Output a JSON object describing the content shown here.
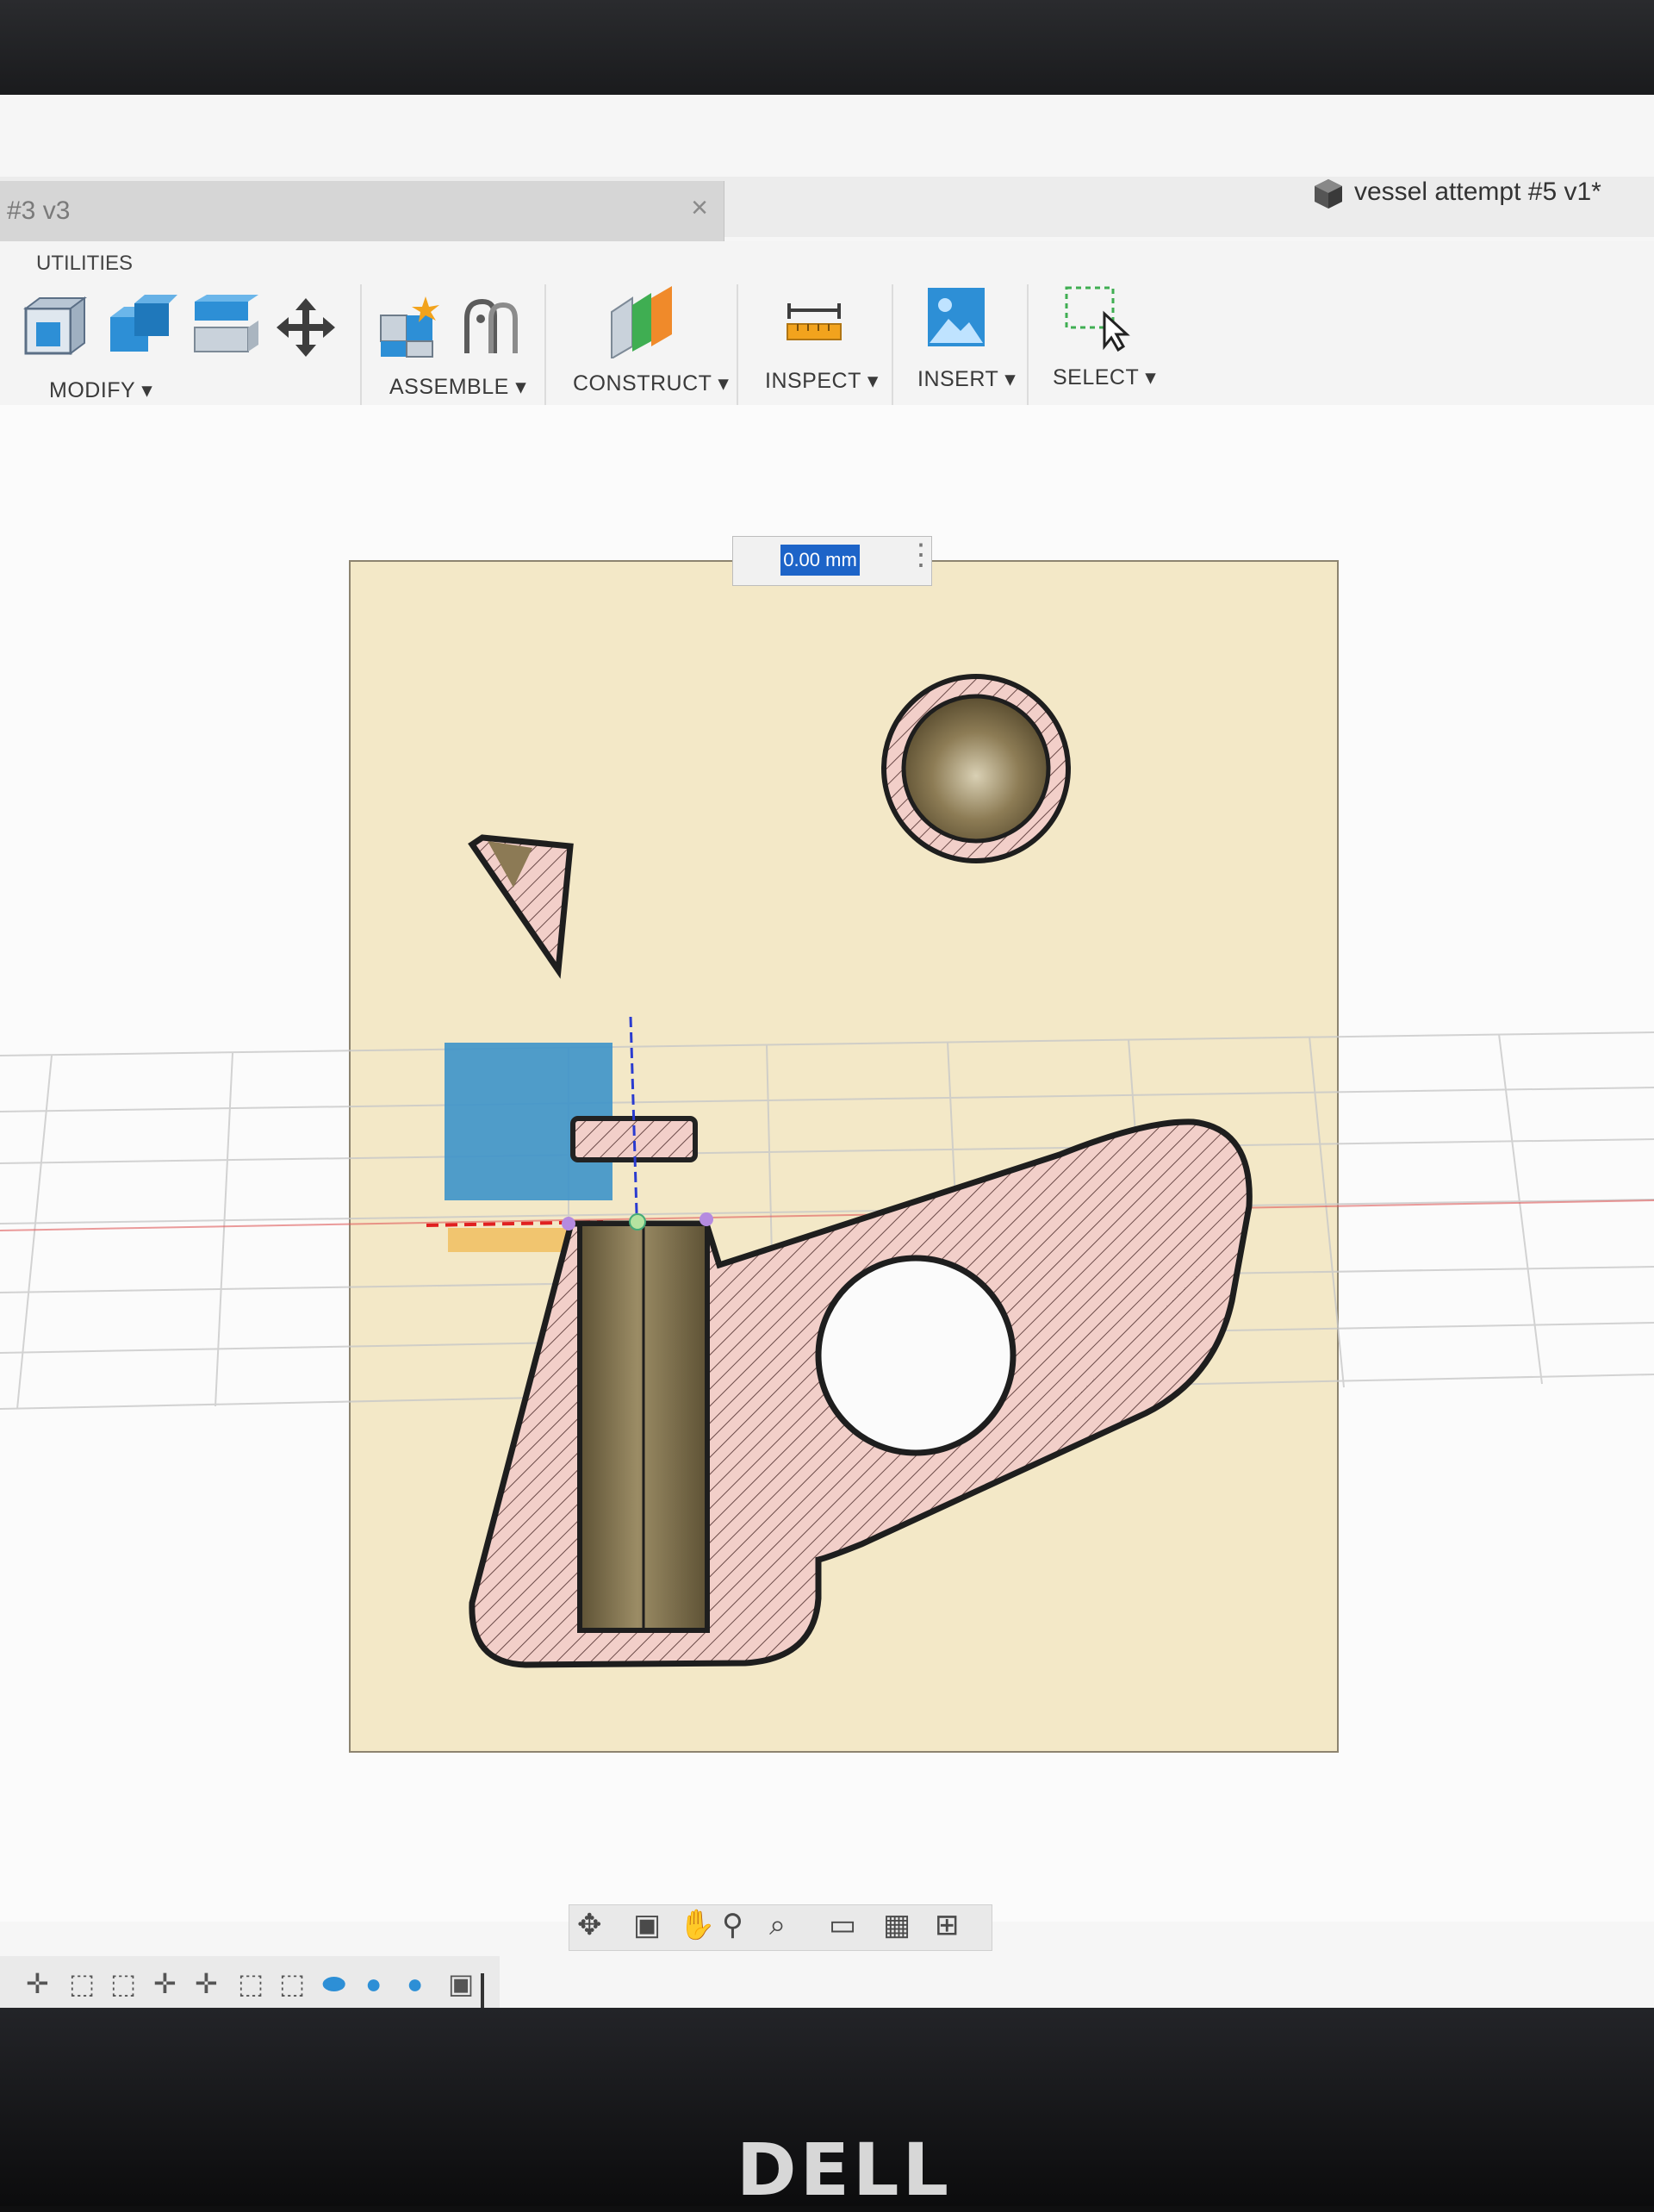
{
  "window": {
    "doc_tab_title": "#3 v3",
    "doc_tab_close": "×",
    "title": "vessel attempt #5 v1*"
  },
  "toolbar": {
    "utilities_label": "UTILITIES",
    "groups": [
      {
        "label": "MODIFY ▾"
      },
      {
        "label": "ASSEMBLE ▾"
      },
      {
        "label": "CONSTRUCT ▾"
      },
      {
        "label": "INSPECT ▾"
      },
      {
        "label": "INSERT ▾"
      },
      {
        "label": "SELECT ▾"
      }
    ]
  },
  "canvas": {
    "dimension_input_value": "0.00 mm",
    "dimension_more_icon": "⋮"
  },
  "nav_bar": {
    "icons": [
      "orbit-icon",
      "look-at-icon",
      "pan-icon",
      "zoom-icon",
      "fit-icon",
      "display-settings-icon",
      "grid-settings-icon",
      "viewports-icon"
    ]
  },
  "timeline": {
    "icons": [
      "sketch-icon",
      "move-icon",
      "sketch-icon",
      "sketch-icon",
      "move-icon",
      "move-icon",
      "sketch-icon",
      "sketch-icon",
      "extrude-icon",
      "sphere-icon",
      "sphere-icon",
      "component-icon"
    ]
  },
  "brand": {
    "monitor_logo": "DELL"
  },
  "colors": {
    "sheet": "#f3e8c7",
    "section_fill": "#f2cfc9",
    "hatch": "#6b4a48",
    "accent_blue": "#1d64c8",
    "plane_blue": "#3d93c9"
  }
}
